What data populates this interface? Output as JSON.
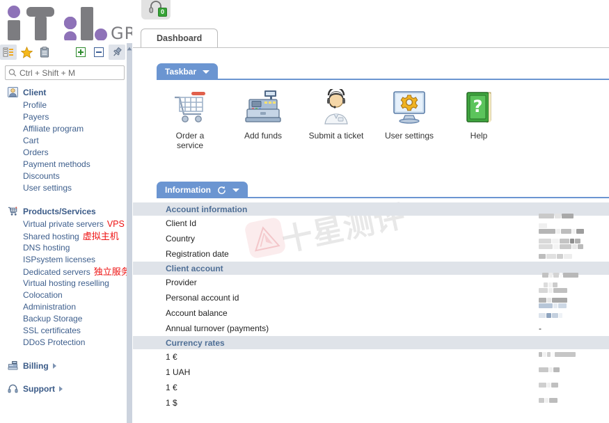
{
  "brand": {
    "logo_text": "GROUP",
    "logo_colors": {
      "gray": "#7c7c80",
      "purple": "#8e72b8"
    }
  },
  "sidebar": {
    "toolbar": [
      {
        "name": "tree-view-icon",
        "label": "Tree view"
      },
      {
        "name": "favorites-star-icon",
        "label": "Favorites"
      },
      {
        "name": "clipboard-icon",
        "label": "Clipboard"
      },
      {
        "name": "expand-all-icon",
        "label": "Expand all"
      },
      {
        "name": "collapse-all-icon",
        "label": "Collapse all"
      },
      {
        "name": "pin-icon",
        "label": "Pin menu"
      }
    ],
    "search": {
      "placeholder": "Ctrl + Shift + M",
      "value": ""
    },
    "groups": [
      {
        "id": "client",
        "label": "Client",
        "icon": "user-icon",
        "has_arrow": false,
        "items": [
          {
            "label": "Profile"
          },
          {
            "label": "Payers"
          },
          {
            "label": "Affiliate program"
          },
          {
            "label": "Cart"
          },
          {
            "label": "Orders"
          },
          {
            "label": "Payment methods"
          },
          {
            "label": "Discounts"
          },
          {
            "label": "User settings"
          }
        ]
      },
      {
        "id": "products-services",
        "label": "Products/Services",
        "icon": "cart-icon",
        "has_arrow": false,
        "items": [
          {
            "label": "Virtual private servers",
            "annotation": "VPS（VDS)",
            "annotation_color": "#ee1111"
          },
          {
            "label": "Shared hosting",
            "annotation": "虚拟主机",
            "annotation_color": "#ee1111",
            "annotation_cjk": true
          },
          {
            "label": "DNS hosting"
          },
          {
            "label": "ISPsystem licenses"
          },
          {
            "label": "Dedicated servers",
            "annotation": "独立服务器",
            "annotation_color": "#ee1111",
            "annotation_cjk": true
          },
          {
            "label": "Virtual hosting reselling"
          },
          {
            "label": "Colocation"
          },
          {
            "label": "Administration"
          },
          {
            "label": "Backup Storage"
          },
          {
            "label": "SSL certificates"
          },
          {
            "label": "DDoS Protection"
          }
        ]
      },
      {
        "id": "billing",
        "label": "Billing",
        "icon": "cash-register-icon",
        "has_arrow": true,
        "items": []
      },
      {
        "id": "support",
        "label": "Support",
        "icon": "headset-icon",
        "has_arrow": true,
        "items": []
      }
    ]
  },
  "topbar": {
    "support_button": {
      "name": "headset-icon",
      "badge": "0",
      "badge_color": "#36a436"
    }
  },
  "tabs": [
    {
      "id": "dashboard",
      "label": "Dashboard",
      "active": true
    }
  ],
  "taskbar_panel": {
    "title": "Taskbar",
    "header_color": "#6b95d1",
    "items": [
      {
        "id": "order-a-service",
        "label": "Order a\nservice",
        "label_line1": "Order a",
        "label_line2": "service",
        "icon": "shopping-cart-icon"
      },
      {
        "id": "add-funds",
        "label": "Add funds",
        "label_line1": "Add funds",
        "label_line2": "",
        "icon": "cash-register-icon"
      },
      {
        "id": "submit-a-ticket",
        "label": "Submit a ticket",
        "label_line1": "Submit a ticket",
        "label_line2": "",
        "icon": "support-agent-icon"
      },
      {
        "id": "user-settings",
        "label": "User settings",
        "label_line1": "User settings",
        "label_line2": "",
        "icon": "monitor-gear-icon"
      },
      {
        "id": "help",
        "label": "Help",
        "label_line1": "Help",
        "label_line2": "",
        "icon": "green-help-book-icon"
      }
    ]
  },
  "information_panel": {
    "title": "Information",
    "header_color": "#6b95d1",
    "refresh_icon": "refresh-icon",
    "dropdown_icon": "chevron-down-icon",
    "sections": [
      {
        "id": "account-information",
        "title": "Account information",
        "rows": [
          {
            "label": "Client Id",
            "value": "",
            "censored": true,
            "cens_pattern": [
              [
                22,
                7
              ],
              [
                16,
                7
              ],
              [
                9,
                7
              ]
            ]
          },
          {
            "label": "Country",
            "value": "",
            "censored": true,
            "cens_pattern": [
              [
                24,
                7
              ],
              [
                7,
                7
              ],
              [
                16,
                7
              ],
              [
                6,
                7
              ],
              [
                14,
                7
              ],
              [
                8,
                7
              ]
            ]
          },
          {
            "label": "Registration date",
            "value": "",
            "censored": true,
            "cens_pattern": [
              [
                20,
                7
              ],
              [
                10,
                7
              ],
              [
                18,
                7
              ],
              [
                6,
                7
              ],
              [
                12,
                7
              ]
            ]
          }
        ]
      },
      {
        "id": "client-account",
        "title": "Client account",
        "rows": [
          {
            "label": "Provider",
            "value": "",
            "censored": true,
            "cens_pattern": [
              [
                10,
                7
              ],
              [
                6,
                7
              ],
              [
                10,
                7
              ],
              [
                22,
                7
              ]
            ]
          },
          {
            "label": "Personal account id",
            "value": "",
            "censored": true,
            "cens_pattern": [
              [
                14,
                7
              ],
              [
                8,
                7
              ],
              [
                26,
                7
              ]
            ]
          },
          {
            "label": "Account balance",
            "value": "",
            "censored": true,
            "cens_blue": true,
            "cens_pattern": [
              [
                20,
                7
              ],
              [
                6,
                7
              ],
              [
                14,
                7
              ]
            ]
          },
          {
            "label": "Annual turnover (payments)",
            "value": "-",
            "censored": false
          }
        ]
      },
      {
        "id": "currency-rates",
        "title": "Currency rates",
        "rows": [
          {
            "label": "1 €",
            "value": "",
            "censored": true,
            "cens_pattern": [
              [
                6,
                7
              ],
              [
                4,
                7
              ],
              [
                30,
                7
              ],
              [
                8,
                7
              ]
            ]
          },
          {
            "label": "1 UAH",
            "value": "",
            "censored": true,
            "cens_pattern": [
              [
                14,
                7
              ],
              [
                6,
                7
              ],
              [
                8,
                7
              ]
            ]
          },
          {
            "label": "1 €",
            "value": "",
            "censored": true,
            "cens_pattern": [
              [
                12,
                7
              ],
              [
                6,
                7
              ],
              [
                10,
                7
              ]
            ]
          },
          {
            "label": "1 $",
            "value": "",
            "censored": true,
            "cens_pattern": [
              [
                8,
                7
              ],
              [
                5,
                7
              ],
              [
                12,
                7
              ]
            ]
          }
        ]
      }
    ]
  },
  "watermark": {
    "text": "十星测评",
    "mark": "triangle-logo-icon"
  }
}
